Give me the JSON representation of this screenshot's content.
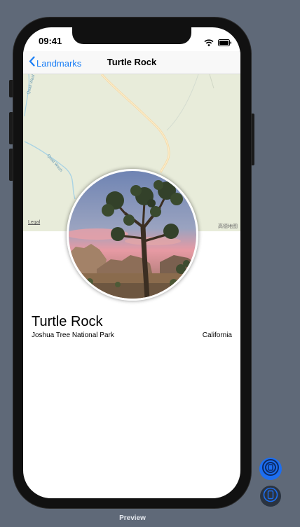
{
  "status_bar": {
    "time": "09:41",
    "wifi_icon": "wifi-icon",
    "battery_icon": "battery-icon"
  },
  "nav": {
    "back_label": "Landmarks",
    "back_icon": "chevron-left-icon",
    "title": "Turtle Rock"
  },
  "map": {
    "legal_label": "Legal",
    "attribution": "高德地图",
    "road_labels": [
      "Quail Wash",
      "Quail Wash"
    ]
  },
  "landmark": {
    "name": "Turtle Rock",
    "park": "Joshua Tree National Park",
    "state": "California"
  },
  "preview": {
    "label": "Preview",
    "live_icon": "live-preview-icon",
    "device_icon": "device-icon"
  },
  "colors": {
    "accent": "#1a7ef5",
    "background": "#5f6978",
    "map_land": "#e8ecda"
  }
}
